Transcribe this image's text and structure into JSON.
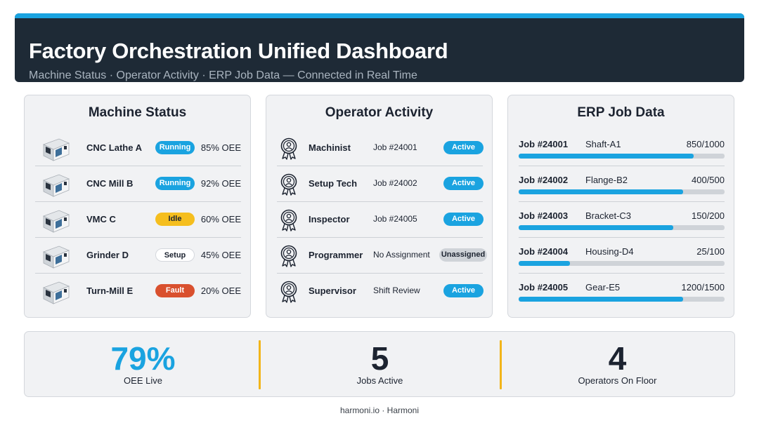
{
  "header": {
    "title": "Factory Orchestration Unified Dashboard",
    "subtitle": "Machine Status · Operator Activity · ERP Job Data — Connected in Real Time"
  },
  "colors": {
    "header_bg": "#1e2a36",
    "accent_blue": "#1aa3e0",
    "idle_yellow": "#f5be1e",
    "fault_red": "#d9502e",
    "divider_gold": "#f2b51a"
  },
  "machine_status": {
    "title": "Machine Status",
    "machines": [
      {
        "name": "CNC Lathe A",
        "status": "Running",
        "oee": "85% OEE",
        "icon": "cnc-lathe-icon"
      },
      {
        "name": "CNC Mill B",
        "status": "Running",
        "oee": "92% OEE",
        "icon": "cnc-mill-icon"
      },
      {
        "name": "VMC C",
        "status": "Idle",
        "oee": "60% OEE",
        "icon": "vmc-icon"
      },
      {
        "name": "Grinder D",
        "status": "Setup",
        "oee": "45% OEE",
        "icon": "grinder-icon"
      },
      {
        "name": "Turn-Mill E",
        "status": "Fault",
        "oee": "20% OEE",
        "icon": "turn-mill-icon"
      }
    ]
  },
  "operator_activity": {
    "title": "Operator Activity",
    "operators": [
      {
        "role": "Machinist",
        "assignment": "Job #24001",
        "status": "Active"
      },
      {
        "role": "Setup Tech",
        "assignment": "Job #24002",
        "status": "Active"
      },
      {
        "role": "Inspector",
        "assignment": "Job #24005",
        "status": "Active"
      },
      {
        "role": "Programmer",
        "assignment": "No Assignment",
        "status": "Unassigned"
      },
      {
        "role": "Supervisor",
        "assignment": "Shift Review",
        "status": "Active"
      }
    ]
  },
  "erp_job_data": {
    "title": "ERP Job Data",
    "jobs": [
      {
        "job": "Job #24001",
        "part": "Shaft-A1",
        "qty": "850/1000",
        "progress": 0.85
      },
      {
        "job": "Job #24002",
        "part": "Flange-B2",
        "qty": "400/500",
        "progress": 0.8
      },
      {
        "job": "Job #24003",
        "part": "Bracket-C3",
        "qty": "150/200",
        "progress": 0.75
      },
      {
        "job": "Job #24004",
        "part": "Housing-D4",
        "qty": "25/100",
        "progress": 0.25
      },
      {
        "job": "Job #24005",
        "part": "Gear-E5",
        "qty": "1200/1500",
        "progress": 0.8
      }
    ]
  },
  "kpis": [
    {
      "value": "79%",
      "label": "OEE Live",
      "color": "#1aa3e0"
    },
    {
      "value": "5",
      "label": "Jobs Active",
      "color": "#1c2330"
    },
    {
      "value": "4",
      "label": "Operators On Floor",
      "color": "#1c2330"
    }
  ],
  "footer": "harmoni.io · Harmoni"
}
